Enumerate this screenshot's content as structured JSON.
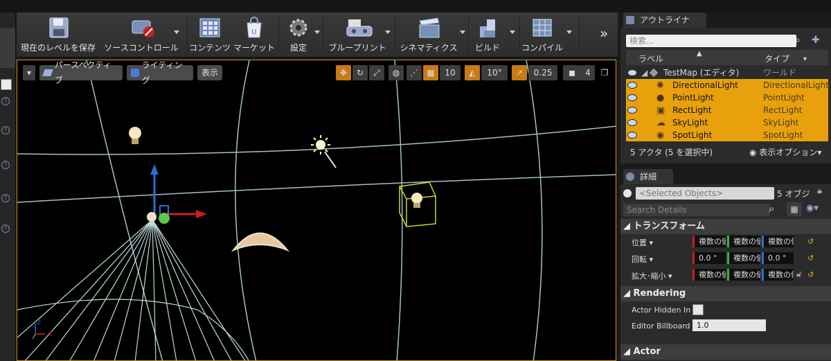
{
  "toolbar": {
    "save_current_level": "現在のレベルを保存",
    "source_control": "ソースコントロール",
    "content": "コンテンツ",
    "marketplace": "マーケット",
    "settings": "設定",
    "blueprints": "ブループリント",
    "cinematics": "シネマティクス",
    "build": "ビルド",
    "compile": "コンパイル",
    "more": "»"
  },
  "viewport": {
    "perspective": "パースペクティブ",
    "lighting": "ライティング",
    "show": "表示",
    "grid_snap": "10",
    "rotation_snap": "10°",
    "scale_snap": "0.25",
    "camera_speed": "4",
    "axis_labels": [
      "Z",
      "X"
    ]
  },
  "outliner": {
    "tab_label": "アウトライナ",
    "search_placeholder": "検索...",
    "col_label": "ラベル",
    "col_type": "タイプ",
    "root": {
      "name": "TestMap (エディタ)",
      "type": "ワールド"
    },
    "items": [
      {
        "name": "DirectionalLight",
        "type": "DirectionalLight"
      },
      {
        "name": "PointLight",
        "type": "PointLight"
      },
      {
        "name": "RectLight",
        "type": "RectLight"
      },
      {
        "name": "SkyLight",
        "type": "SkyLight"
      },
      {
        "name": "SpotLight",
        "type": "SpotLight"
      }
    ],
    "status": "5 アクタ (5 を選択中)",
    "view_options": "表示オプション"
  },
  "details": {
    "tab_label": "詳細",
    "selected_objects": "<Selected Objects>",
    "count_suffix": "5 オブジ",
    "search_placeholder": "Search Details",
    "transform_section": "トランスフォーム",
    "location_label": "位置",
    "rotation_label": "回転",
    "scale_label": "拡大･縮小",
    "location": [
      "複数の値",
      "複数の値",
      "複数の値"
    ],
    "rotation": [
      "0.0 °",
      "複数の値",
      "0.0 °"
    ],
    "scale": [
      "複数の値",
      "複数の値",
      "複数の値"
    ],
    "rendering_section": "Rendering",
    "actor_hidden_label": "Actor Hidden In",
    "editor_billboard_label": "Editor Billboard",
    "editor_billboard_value": "1.0",
    "actor_section": "Actor"
  },
  "colors": {
    "accent": "#e8a10c",
    "selection": "#c8961e"
  }
}
